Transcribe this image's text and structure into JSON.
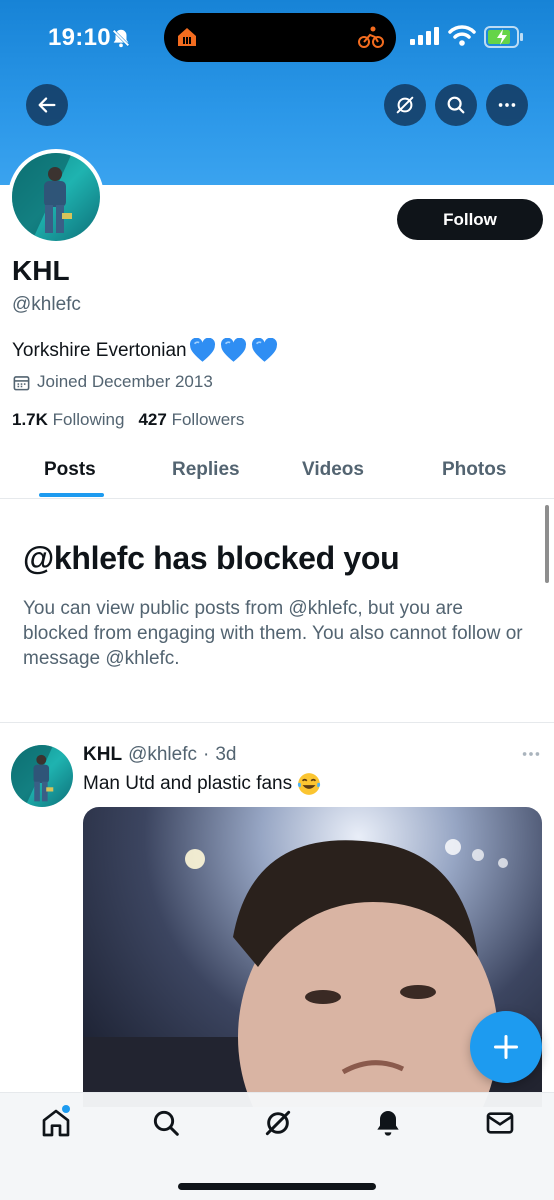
{
  "status_bar": {
    "time": "19:10"
  },
  "profile": {
    "display_name": "KHL",
    "handle": "@khlefc",
    "bio": "Yorkshire Evertonian",
    "bio_emoji": "blue-heart x3",
    "joined": "Joined December 2013",
    "following_count": "1.7K",
    "following_label": "Following",
    "followers_count": "427",
    "followers_label": "Followers",
    "follow_button": "Follow"
  },
  "tabs": [
    {
      "label": "Posts",
      "active": true
    },
    {
      "label": "Replies",
      "active": false
    },
    {
      "label": "Videos",
      "active": false
    },
    {
      "label": "Photos",
      "active": false
    }
  ],
  "blocked": {
    "title": "@khlefc has blocked you",
    "message": "You can view public posts from @khlefc, but you are blocked from engaging with them. You also cannot follow or message @khlefc."
  },
  "post": {
    "name": "KHL",
    "handle": "@khlefc",
    "separator": "·",
    "time": "3d",
    "text": "Man Utd and plastic fans",
    "emoji": "face-with-tears-of-joy"
  },
  "bottom_nav": [
    "home-icon",
    "search-icon",
    "grok-icon",
    "notifications-icon",
    "messages-icon"
  ],
  "colors": {
    "accent": "#1d9bf0",
    "banner": "#2b97e8",
    "text": "#0f1419",
    "secondary_text": "#536471"
  }
}
